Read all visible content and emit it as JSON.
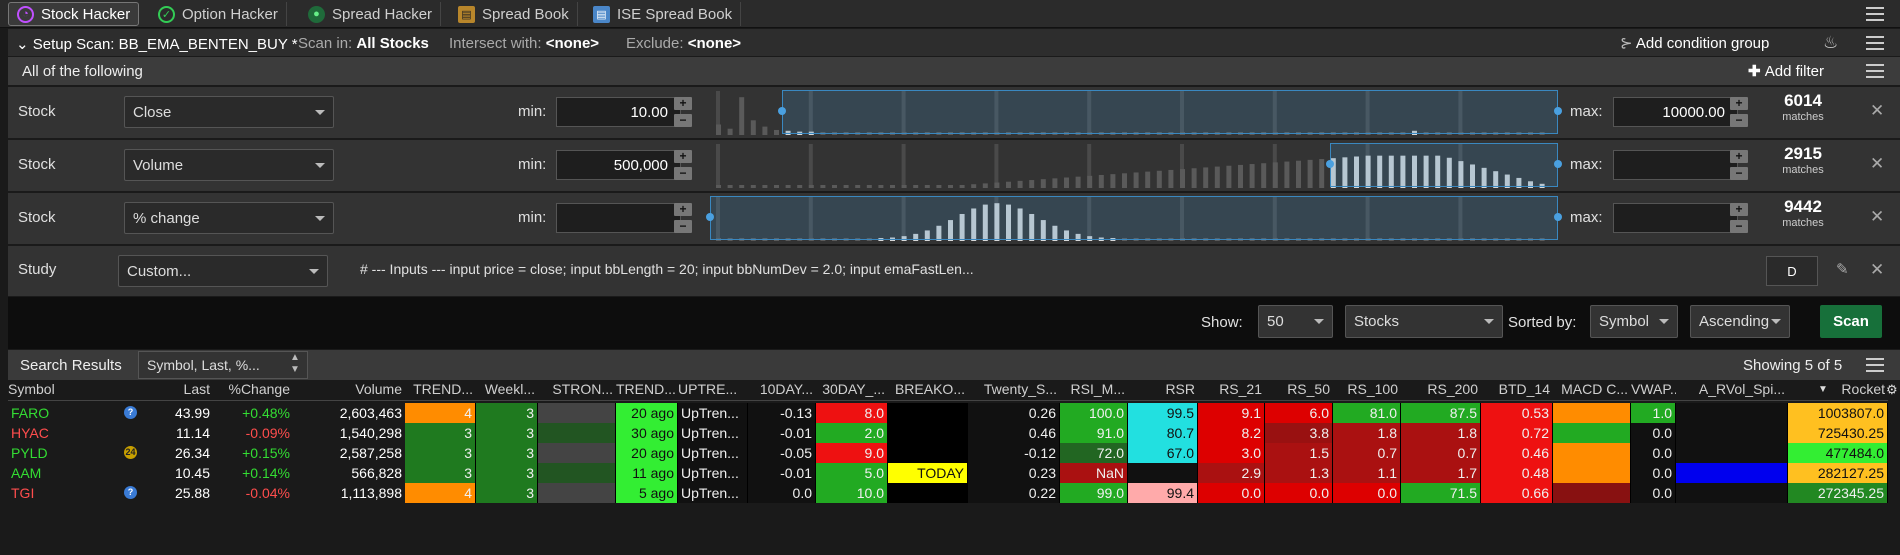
{
  "tabs": [
    {
      "label": "Stock Hacker",
      "icon": "stock-hacker-icon",
      "active": true
    },
    {
      "label": "Option Hacker",
      "icon": "option-hacker-icon"
    },
    {
      "label": "Spread Hacker",
      "icon": "spread-hacker-icon"
    },
    {
      "label": "Spread Book",
      "icon": "spread-book-icon"
    },
    {
      "label": "ISE Spread Book",
      "icon": "ise-spread-book-icon"
    }
  ],
  "setup": {
    "scan_label": "Setup Scan: BB_EMA_BENTEN_BUY *",
    "scan_in_label": "Scan in:",
    "scan_in_value": "All Stocks",
    "intersect_label": "Intersect with:",
    "intersect_value": "<none>",
    "exclude_label": "Exclude:",
    "exclude_value": "<none>",
    "add_condition_group": "Add condition group"
  },
  "all_of": "All of the following",
  "add_filter": "Add filter",
  "filters": [
    {
      "type": "Stock",
      "field": "Close",
      "min_label": "min:",
      "min": "10.00",
      "max_label": "max:",
      "max": "10000.00",
      "matches": "6014",
      "matches_label": "matches"
    },
    {
      "type": "Stock",
      "field": "Volume",
      "min_label": "min:",
      "min": "500,000",
      "max_label": "max:",
      "max": "",
      "matches": "2915",
      "matches_label": "matches"
    },
    {
      "type": "Stock",
      "field": "% change",
      "min_label": "min:",
      "min": "",
      "max_label": "max:",
      "max": "",
      "matches": "9442",
      "matches_label": "matches"
    }
  ],
  "study": {
    "type": "Study",
    "field": "Custom...",
    "code": "# --- Inputs --- input price = close; input bbLength = 20; input bbNumDev = 2.0; input emaFastLen...",
    "d_button": "D"
  },
  "controls": {
    "show_label": "Show:",
    "show_value": "50",
    "type_value": "Stocks",
    "sorted_label": "Sorted by:",
    "sort_field": "Symbol",
    "sort_order": "Ascending",
    "scan_button": "Scan"
  },
  "results": {
    "title": "Search Results",
    "columns_set": "Symbol, Last, %...",
    "showing": "Showing 5 of 5"
  },
  "headers": [
    "Symbol",
    "Last",
    "%Change",
    "Volume",
    "TREND...",
    "Weekl...",
    "STRON...",
    "TREND...",
    "UPTRE...",
    "10DAY...",
    "30DAY_...",
    "BREAKO...",
    "Twenty_S...",
    "RSI_M...",
    "RSR",
    "RS_21",
    "RS_50",
    "RS_100",
    "RS_200",
    "BTD_14",
    "MACD C...",
    "VWAP...",
    "A_RVol_Spi...",
    "Rocket"
  ],
  "rows": [
    {
      "badge": "?",
      "cells": [
        "FARO",
        "43.99",
        "+0.48%",
        "2,603,463",
        "4",
        "3",
        "",
        "20 ago",
        "UpTren...",
        "-0.13",
        "8.0",
        "",
        "0.26",
        "100.0",
        "99.5",
        "9.1",
        "6.0",
        "81.0",
        "87.5",
        "0.53",
        "",
        "1.0",
        "",
        "1003807.0"
      ]
    },
    {
      "badge": "",
      "cells": [
        "HYAC",
        "11.14",
        "-0.09%",
        "1,540,298",
        "3",
        "3",
        "",
        "30 ago",
        "UpTren...",
        "-0.01",
        "2.0",
        "",
        "0.46",
        "91.0",
        "80.7",
        "8.2",
        "3.8",
        "1.8",
        "1.8",
        "0.72",
        "",
        "0.0",
        "",
        "725430.25"
      ]
    },
    {
      "badge": "24",
      "cells": [
        "PYLD",
        "26.34",
        "+0.15%",
        "2,587,258",
        "3",
        "3",
        "",
        "20 ago",
        "UpTren...",
        "-0.05",
        "9.0",
        "",
        "-0.12",
        "72.0",
        "67.0",
        "3.0",
        "1.5",
        "0.7",
        "0.7",
        "0.46",
        "",
        "0.0",
        "",
        "477484.0"
      ]
    },
    {
      "badge": "",
      "cells": [
        "AAM",
        "10.45",
        "+0.14%",
        "566,828",
        "3",
        "3",
        "",
        "11 ago",
        "UpTren...",
        "-0.01",
        "5.0",
        "TODAY",
        "0.23",
        "NaN",
        "",
        "2.9",
        "1.3",
        "1.1",
        "1.7",
        "0.48",
        "",
        "0.0",
        "",
        "282127.25"
      ]
    },
    {
      "badge": "?",
      "cells": [
        "TGI",
        "25.88",
        "-0.04%",
        "1,113,898",
        "4",
        "3",
        "",
        "5 ago",
        "UpTren...",
        "0.0",
        "10.0",
        "",
        "0.22",
        "99.0",
        "99.4",
        "0.0",
        "0.0",
        "0.0",
        "71.5",
        "0.66",
        "",
        "0.0",
        "",
        "272345.25"
      ]
    }
  ],
  "colors": [
    [
      "#1a1a1a",
      "#1a1a1a",
      "#1a1a1a",
      "#1a1a1a",
      "#ff8c00",
      "#1f7a1f",
      "#444444",
      "#33ee33",
      "#111111",
      "#111111",
      "#ee1111",
      "#000000",
      "#111111",
      "#22aa22",
      "#22e0e0",
      "#dd0000",
      "#dd0000",
      "#22aa22",
      "#22aa22",
      "#ee1111",
      "#ff8c00",
      "#22aa22",
      "#111111",
      "#ffc020"
    ],
    [
      "#1a1a1a",
      "#1a1a1a",
      "#1a1a1a",
      "#1a1a1a",
      "#1f7a1f",
      "#1f7a1f",
      "#225522",
      "#33ee33",
      "#111111",
      "#111111",
      "#22aa22",
      "#000000",
      "#111111",
      "#22aa22",
      "#22e0e0",
      "#dd0000",
      "#991111",
      "#aa1111",
      "#aa1111",
      "#ee1111",
      "#22aa22",
      "#111111",
      "#111111",
      "#ffc020"
    ],
    [
      "#1a1a1a",
      "#1a1a1a",
      "#1a1a1a",
      "#1a1a1a",
      "#1f7a1f",
      "#1f7a1f",
      "#444444",
      "#33ee33",
      "#111111",
      "#111111",
      "#ee1111",
      "#000000",
      "#111111",
      "#226622",
      "#22e0e0",
      "#dd0000",
      "#aa1111",
      "#aa1111",
      "#aa1111",
      "#ee1111",
      "#ff8c00",
      "#111111",
      "#111111",
      "#33ee33"
    ],
    [
      "#1a1a1a",
      "#1a1a1a",
      "#1a1a1a",
      "#1a1a1a",
      "#1f7a1f",
      "#1f7a1f",
      "#225522",
      "#33ee33",
      "#111111",
      "#111111",
      "#22aa22",
      "#ffff00",
      "#111111",
      "#aa1111",
      "#111111",
      "#aa1111",
      "#aa1111",
      "#aa1111",
      "#aa1111",
      "#ee1111",
      "#ff8c00",
      "#111111",
      "#0000ee",
      "#ffc020"
    ],
    [
      "#1a1a1a",
      "#1a1a1a",
      "#1a1a1a",
      "#1a1a1a",
      "#ff8c00",
      "#1f7a1f",
      "#444444",
      "#33ee33",
      "#111111",
      "#111111",
      "#22aa22",
      "#000000",
      "#111111",
      "#22aa22",
      "#ffaaaa",
      "#dd0000",
      "#dd0000",
      "#dd0000",
      "#22aa22",
      "#ee1111",
      "#881111",
      "#111111",
      "#111111",
      "#228822"
    ]
  ]
}
